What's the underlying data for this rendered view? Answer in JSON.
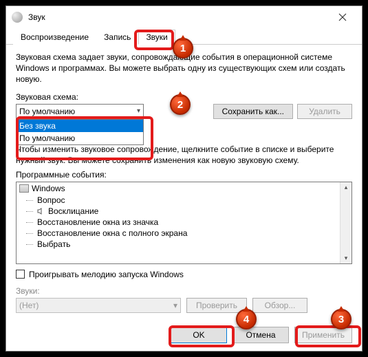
{
  "window": {
    "title": "Звук"
  },
  "tabs": {
    "playback": "Воспроизведение",
    "recording": "Запись",
    "sounds": "Звуки"
  },
  "description": "Звуковая схема задает звуки, сопровождающие события в операционной системе Windows и программах. Вы можете выбрать одну из существующих схем или создать новую.",
  "scheme": {
    "label": "Звуковая схема:",
    "selected": "По умолчанию",
    "options": {
      "none": "Без звука",
      "default": "По умолчанию"
    }
  },
  "buttons": {
    "save_as": "Сохранить как...",
    "delete": "Удалить",
    "test": "Проверить",
    "browse": "Обзор...",
    "ok": "OK",
    "cancel": "Отмена",
    "apply": "Применить"
  },
  "hint": "Чтобы изменить звуковое сопровождение, щелкните событие в списке и выберите нужный звук. Вы можете сохранить изменения как новую звуковую схему.",
  "events": {
    "label": "Программные события:",
    "root": "Windows",
    "items": {
      "e1": "Вопрос",
      "e2": "Восклицание",
      "e3": "Восстановление окна из значка",
      "e4": "Восстановление окна с полного экрана",
      "e5": "Выбрать"
    }
  },
  "play_melody": "Проигрывать мелодию запуска Windows",
  "sounds_section": {
    "label": "Звуки:",
    "value": "(Нет)"
  },
  "badges": {
    "b1": "1",
    "b2": "2",
    "b3": "3",
    "b4": "4"
  }
}
